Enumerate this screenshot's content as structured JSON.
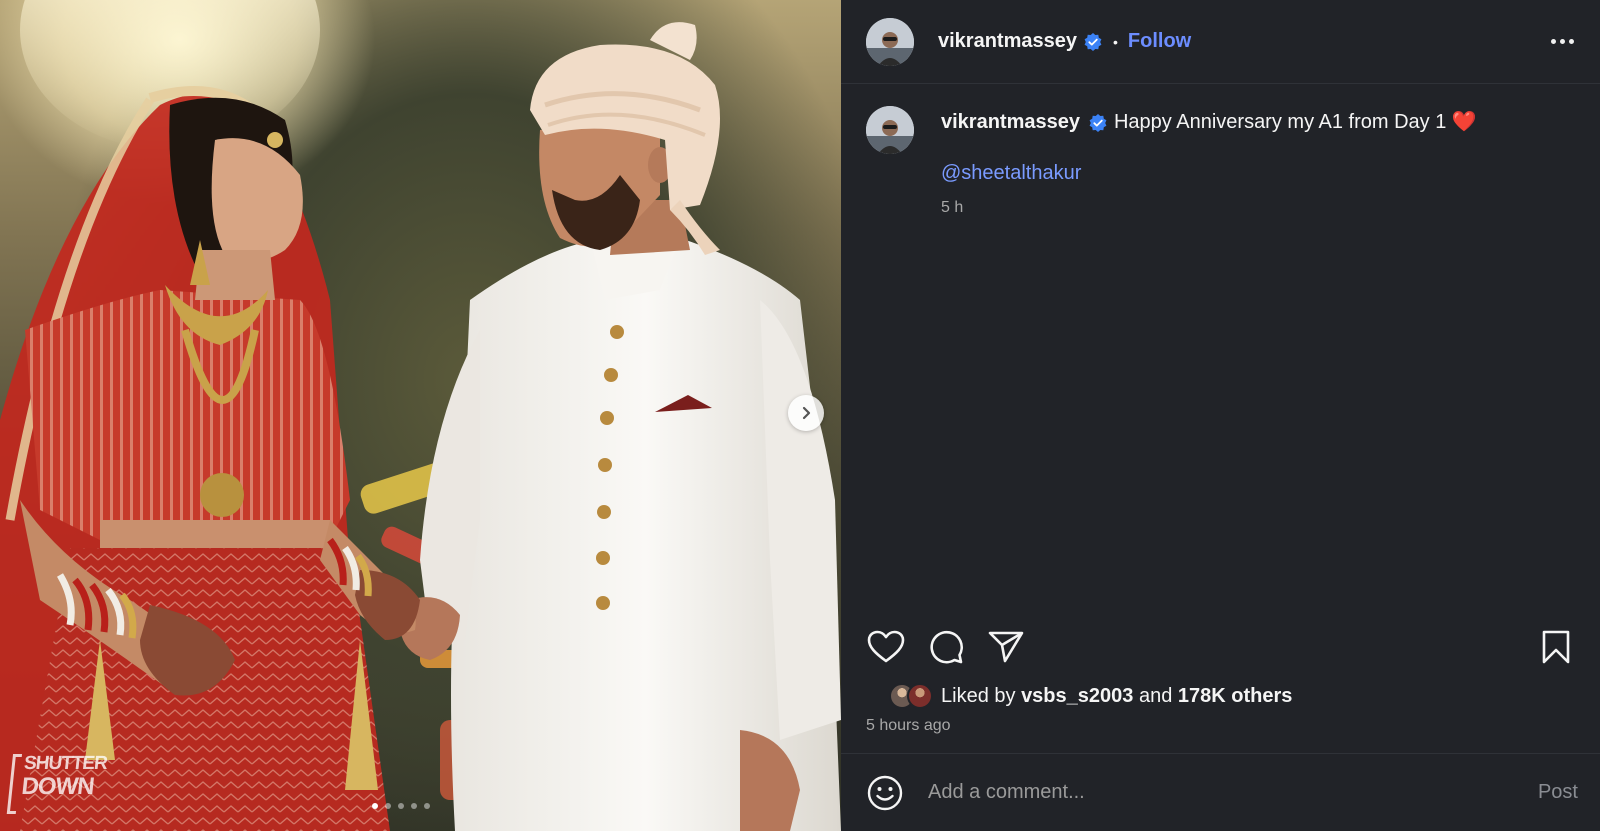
{
  "post": {
    "username": "vikrantmassey",
    "follow_label": "Follow",
    "separator": "•",
    "caption_text": "Happy Anniversary my A1 from Day 1",
    "caption_emoji": "❤️",
    "mention": "@sheetalthakur",
    "caption_time": "5 h",
    "likes_prefix": "Liked by",
    "liked_by_user": "vsbs_s2003",
    "likes_and": "and",
    "likes_others": "178K others",
    "posted_ago": "5 hours ago"
  },
  "media": {
    "watermark_line1": "SHUTTER",
    "watermark_line2": "DOWN",
    "carousel_count": 5,
    "carousel_active_index": 0
  },
  "comment": {
    "placeholder": "Add a comment...",
    "post_label": "Post"
  },
  "icons": {
    "verified": "verified-badge-icon",
    "more": "more-options-icon",
    "like": "heart-icon",
    "comment": "comment-bubble-icon",
    "share": "paper-plane-icon",
    "save": "bookmark-icon",
    "emoji": "emoji-smiley-icon",
    "next": "chevron-right-icon"
  },
  "colors": {
    "panel_bg": "#212328",
    "link_blue": "#6c8dff",
    "verified_blue": "#3b82f6",
    "muted_text": "#a8a8a8"
  }
}
